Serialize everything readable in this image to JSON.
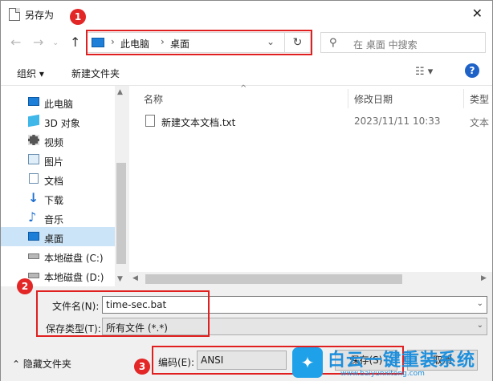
{
  "window": {
    "title": "另存为"
  },
  "nav": {
    "back_icon": "arrow-left-icon",
    "forward_icon": "arrow-right-icon",
    "up_icon": "arrow-up-icon",
    "address": [
      "此电脑",
      "桌面"
    ],
    "search_placeholder": "在 桌面 中搜索"
  },
  "toolbar": {
    "organize": "组织 ▾",
    "new_folder": "新建文件夹"
  },
  "tree": [
    {
      "label": "此电脑",
      "icon": "pc-icon"
    },
    {
      "label": "3D 对象",
      "icon": "cube-icon"
    },
    {
      "label": "视频",
      "icon": "video-icon"
    },
    {
      "label": "图片",
      "icon": "picture-icon"
    },
    {
      "label": "文档",
      "icon": "document-icon"
    },
    {
      "label": "下载",
      "icon": "download-icon"
    },
    {
      "label": "音乐",
      "icon": "music-icon"
    },
    {
      "label": "桌面",
      "icon": "desktop-icon",
      "selected": true
    },
    {
      "label": "本地磁盘 (C:)",
      "icon": "drive-icon"
    },
    {
      "label": "本地磁盘 (D:)",
      "icon": "drive-icon"
    }
  ],
  "columns": {
    "name": "名称",
    "date": "修改日期",
    "type": "类型"
  },
  "files": [
    {
      "name": "新建文本文档.txt",
      "date": "2023/11/11 10:33",
      "type": "文本"
    }
  ],
  "form": {
    "filename_label": "文件名(N):",
    "filename_value": "time-sec.bat",
    "filetype_label": "保存类型(T):",
    "filetype_value": "所有文件  (*.*)"
  },
  "bottom": {
    "hide_folders": "隐藏文件夹",
    "encoding_label": "编码(E):",
    "encoding_value": "ANSI",
    "save": "保存(S)",
    "cancel": "取消"
  },
  "badges": [
    "1",
    "2",
    "3"
  ],
  "watermark": {
    "title": "白云一键重装系统",
    "url": "www.baiyunxitong.com"
  },
  "colors": {
    "highlight": "#e02020",
    "selection": "#cce4f7",
    "accent": "#1e7fd8"
  }
}
